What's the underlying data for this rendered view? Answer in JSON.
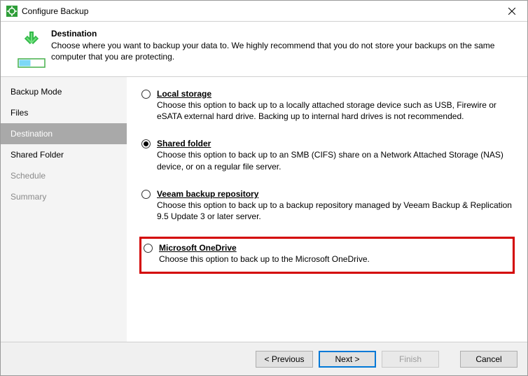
{
  "title": "Configure Backup",
  "header": {
    "title": "Destination",
    "desc": "Choose where you want to backup your data to. We highly recommend that you do not store your backups on the same computer that you are protecting."
  },
  "sidebar": {
    "items": [
      {
        "label": "Backup Mode",
        "state": "past"
      },
      {
        "label": "Files",
        "state": "past"
      },
      {
        "label": "Destination",
        "state": "selected"
      },
      {
        "label": "Shared Folder",
        "state": "past"
      },
      {
        "label": "Schedule",
        "state": "future"
      },
      {
        "label": "Summary",
        "state": "future"
      }
    ]
  },
  "options": [
    {
      "title": "Local storage",
      "desc": "Choose this option to back up to a locally attached storage device such as USB, Firewire or eSATA external hard drive. Backing up to internal hard drives is not recommended.",
      "checked": false,
      "highlight": false
    },
    {
      "title": "Shared folder",
      "desc": "Choose this option to back up to an SMB (CIFS) share on a Network Attached Storage (NAS) device, or on a regular file server.",
      "checked": true,
      "highlight": false
    },
    {
      "title": "Veeam backup repository",
      "desc": "Choose this option to back up to a backup repository managed by Veeam Backup & Replication 9.5 Update 3 or later server.",
      "checked": false,
      "highlight": false
    },
    {
      "title": "Microsoft OneDrive",
      "desc": "Choose this option to back up to the Microsoft OneDrive.",
      "checked": false,
      "highlight": true
    }
  ],
  "buttons": {
    "previous": "<  Previous",
    "next": "Next  >",
    "finish": "Finish",
    "cancel": "Cancel"
  }
}
